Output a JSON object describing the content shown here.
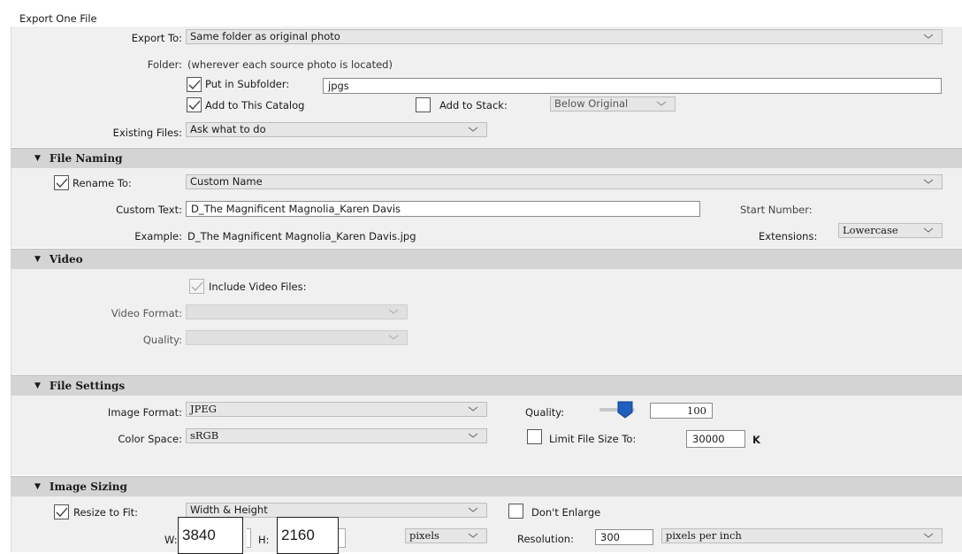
{
  "dialog": {
    "title": "Export One File"
  },
  "location": {
    "export_to_label": "Export To:",
    "export_to_value": "Same folder as original photo",
    "folder_label": "Folder:",
    "folder_value": "(wherever each source photo is located)",
    "subfolder_label": "Put in Subfolder:",
    "subfolder_checked": true,
    "subfolder_value": "jpgs",
    "add_catalog_label": "Add to This Catalog",
    "add_catalog_checked": true,
    "add_stack_label": "Add to Stack:",
    "add_stack_checked": false,
    "stack_value": "Below Original",
    "existing_files_label": "Existing Files:",
    "existing_files_value": "Ask what to do"
  },
  "file_naming": {
    "section_title": "File Naming",
    "rename_label": "Rename To:",
    "rename_checked": true,
    "rename_value": "Custom Name",
    "custom_text_label": "Custom Text:",
    "custom_text_value": "D_The Magnificent Magnolia_Karen Davis",
    "start_number_label": "Start Number:",
    "example_label": "Example:",
    "example_value": "D_The Magnificent Magnolia_Karen Davis.jpg",
    "extensions_label": "Extensions:",
    "extensions_value": "Lowercase"
  },
  "video": {
    "section_title": "Video",
    "include_label": "Include Video Files:",
    "include_checked": true,
    "format_label": "Video Format:",
    "quality_label": "Quality:"
  },
  "file_settings": {
    "section_title": "File Settings",
    "image_format_label": "Image Format:",
    "image_format_value": "JPEG",
    "quality_label": "Quality:",
    "quality_value": "100",
    "quality_fraction": 1.0,
    "color_space_label": "Color Space:",
    "color_space_value": "sRGB",
    "limit_label": "Limit File Size To:",
    "limit_checked": false,
    "limit_value": "30000",
    "limit_unit": "K"
  },
  "image_sizing": {
    "section_title": "Image Sizing",
    "resize_label": "Resize to Fit:",
    "resize_checked": true,
    "resize_value": "Width & Height",
    "dont_enlarge_label": "Don't Enlarge",
    "dont_enlarge_checked": false,
    "w_label": "W:",
    "w_value": "3840",
    "h_label": "H:",
    "h_value": "2160",
    "units_value": "pixels",
    "resolution_label": "Resolution:",
    "resolution_value": "300",
    "resolution_units": "pixels per inch"
  },
  "colors": {
    "section_bg": "#d4d4d4",
    "panel_bg": "#f0f0f0",
    "slider_thumb": "#1f5fbf"
  }
}
